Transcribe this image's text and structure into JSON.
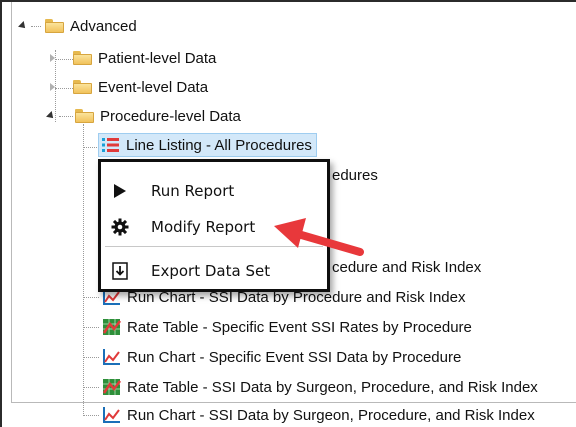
{
  "tree": {
    "advanced": "Advanced",
    "patient": "Patient-level Data",
    "event": "Event-level Data",
    "procedure": "Procedure-level Data",
    "reports": [
      "Line Listing - All Procedures",
      "edures",
      "cedure and Risk Index",
      "Run Chart - SSI Data by Procedure and Risk Index",
      "Rate Table - Specific Event SSI Rates by Procedure",
      "Run Chart - Specific Event SSI Data by Procedure",
      "Rate Table - SSI Data by Surgeon, Procedure, and Risk Index",
      "Run Chart - SSI Data by Surgeon, Procedure, and Risk Index"
    ]
  },
  "context_menu": {
    "run": "Run Report",
    "modify": "Modify Report",
    "export": "Export Data Set"
  },
  "colors": {
    "selection": "#d3e8f9",
    "callout_arrow": "#e8383b"
  }
}
